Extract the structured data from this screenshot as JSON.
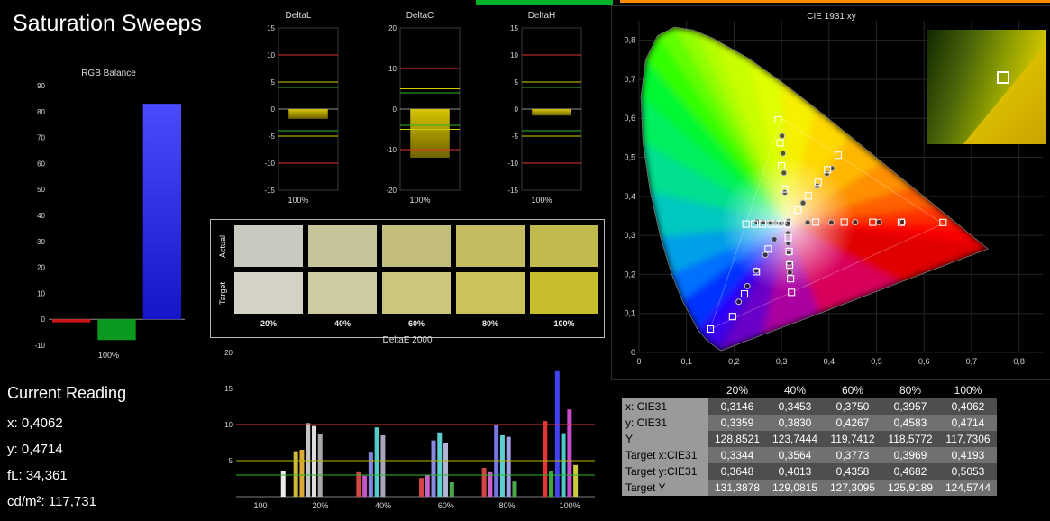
{
  "title": "Saturation Sweeps",
  "current_reading": {
    "heading": "Current Reading",
    "lines": [
      "x: 0,4062",
      "y: 0,4714",
      "fL: 34,361",
      "cd/m²: 117,731"
    ]
  },
  "swatches": {
    "row_labels": [
      "Actual",
      "Target"
    ],
    "col_labels": [
      "20%",
      "40%",
      "60%",
      "80%",
      "100%"
    ],
    "actual": [
      "#cac9c0",
      "#c7c39b",
      "#c4be7e",
      "#c3bc62",
      "#c0b94c"
    ],
    "target": [
      "#d3d2c4",
      "#cfcba0",
      "#ccc67c",
      "#cac25a",
      "#c6bf2b"
    ]
  },
  "table": {
    "headers": [
      "20%",
      "40%",
      "60%",
      "80%",
      "100%"
    ],
    "rows": [
      {
        "label": "x: CIE31",
        "values": [
          "0,3146",
          "0,3453",
          "0,3750",
          "0,3957",
          "0,4062"
        ]
      },
      {
        "label": "y: CIE31",
        "values": [
          "0,3359",
          "0,3830",
          "0,4267",
          "0,4583",
          "0,4714"
        ]
      },
      {
        "label": "Y",
        "values": [
          "128,8521",
          "123,7444",
          "119,7412",
          "118,5772",
          "117,7306"
        ]
      },
      {
        "label": "Target x:CIE31",
        "values": [
          "0,3344",
          "0,3564",
          "0,3773",
          "0,3969",
          "0,4193"
        ]
      },
      {
        "label": "Target y:CIE31",
        "values": [
          "0,3648",
          "0,4013",
          "0,4358",
          "0,4682",
          "0,5053"
        ]
      },
      {
        "label": "Target Y",
        "values": [
          "131,3878",
          "129,0815",
          "127,3095",
          "125,9189",
          "124,5744"
        ]
      }
    ]
  },
  "chart_data": [
    {
      "id": "rgb_balance",
      "type": "bar",
      "title": "RGB Balance",
      "xlabel": "100%",
      "ylim": [
        -10,
        90
      ],
      "yticks": [
        90,
        80,
        70,
        60,
        50,
        40,
        30,
        20,
        10,
        0,
        -10
      ],
      "series": [
        {
          "name": "red",
          "value": -1.2,
          "color": "#cc1414"
        },
        {
          "name": "green",
          "value": -8,
          "color": "#0a9a20"
        },
        {
          "name": "blue",
          "value": 83,
          "color": "#2525e8"
        }
      ]
    },
    {
      "id": "deltaL",
      "type": "delta-bar",
      "title": "DeltaL",
      "xlabel": "100%",
      "ylim": [
        -15,
        15
      ],
      "yticks": [
        15,
        10,
        5,
        0,
        -5,
        -10,
        -15
      ],
      "value": -1.8,
      "ref_lines": [
        {
          "v": 10,
          "color": "#e03434"
        },
        {
          "v": 5,
          "color": "#d0d000"
        },
        {
          "v": 4,
          "color": "#2cb82c"
        },
        {
          "v": -4,
          "color": "#2cb82c"
        },
        {
          "v": -5,
          "color": "#d0d000"
        },
        {
          "v": -10,
          "color": "#e03434"
        }
      ]
    },
    {
      "id": "deltaC",
      "type": "delta-bar",
      "title": "DeltaC",
      "xlabel": "100%",
      "ylim": [
        -20,
        20
      ],
      "yticks": [
        20,
        10,
        0,
        -10,
        -20
      ],
      "value": -12,
      "ref_lines": [
        {
          "v": 10,
          "color": "#e03434"
        },
        {
          "v": 5,
          "color": "#d0d000"
        },
        {
          "v": 4,
          "color": "#2cb82c"
        },
        {
          "v": -4,
          "color": "#2cb82c"
        },
        {
          "v": -5,
          "color": "#d0d000"
        },
        {
          "v": -10,
          "color": "#e03434"
        }
      ]
    },
    {
      "id": "deltaH",
      "type": "delta-bar",
      "title": "DeltaH",
      "xlabel": "100%",
      "ylim": [
        -15,
        15
      ],
      "yticks": [
        15,
        10,
        5,
        0,
        -5,
        -10,
        -15
      ],
      "value": -1.2,
      "ref_lines": [
        {
          "v": 10,
          "color": "#e03434"
        },
        {
          "v": 5,
          "color": "#d0d000"
        },
        {
          "v": 4,
          "color": "#2cb82c"
        },
        {
          "v": -4,
          "color": "#2cb82c"
        },
        {
          "v": -5,
          "color": "#d0d000"
        },
        {
          "v": -10,
          "color": "#e03434"
        }
      ]
    },
    {
      "id": "deltaE2000",
      "type": "history-bar",
      "title": "DeltaE 2000",
      "ylim": [
        0,
        20
      ],
      "yticks": [
        20,
        15,
        10,
        5
      ],
      "xticklabels": [
        "100",
        "20%",
        "40%",
        "60%",
        "80%",
        "100%"
      ],
      "xtickpos": [
        0.068,
        0.235,
        0.41,
        0.585,
        0.755,
        0.93
      ],
      "ref_lines": [
        {
          "v": 10,
          "color": "#e03434"
        },
        {
          "v": 5,
          "color": "#b8b800"
        },
        {
          "v": 3,
          "color": "#2cb82c"
        }
      ],
      "bars": [
        {
          "x": 0.125,
          "h": 3.6,
          "c": "#ececec"
        },
        {
          "x": 0.16,
          "h": 6.3,
          "c": "#cdb93a"
        },
        {
          "x": 0.177,
          "h": 6.5,
          "c": "#d9aa35"
        },
        {
          "x": 0.194,
          "h": 10.2,
          "c": "#c4c4c4"
        },
        {
          "x": 0.211,
          "h": 9.8,
          "c": "#dedede"
        },
        {
          "x": 0.228,
          "h": 8.7,
          "c": "#a9a9a9"
        },
        {
          "x": 0.335,
          "h": 3.4,
          "c": "#d24646"
        },
        {
          "x": 0.352,
          "h": 2.9,
          "c": "#c555c5"
        },
        {
          "x": 0.369,
          "h": 6.1,
          "c": "#8484da"
        },
        {
          "x": 0.386,
          "h": 9.6,
          "c": "#55caca"
        },
        {
          "x": 0.403,
          "h": 8.5,
          "c": "#a6a6bd"
        },
        {
          "x": 0.51,
          "h": 2.6,
          "c": "#d24646"
        },
        {
          "x": 0.527,
          "h": 3.0,
          "c": "#c861c8"
        },
        {
          "x": 0.544,
          "h": 7.8,
          "c": "#8989e2"
        },
        {
          "x": 0.561,
          "h": 8.9,
          "c": "#5cd0d0"
        },
        {
          "x": 0.578,
          "h": 7.5,
          "c": "#b4b4d4"
        },
        {
          "x": 0.595,
          "h": 2.0,
          "c": "#4aa94a"
        },
        {
          "x": 0.685,
          "h": 4.0,
          "c": "#d24646"
        },
        {
          "x": 0.702,
          "h": 3.4,
          "c": "#c861c8"
        },
        {
          "x": 0.719,
          "h": 9.9,
          "c": "#7474e4"
        },
        {
          "x": 0.736,
          "h": 8.5,
          "c": "#5cd0d0"
        },
        {
          "x": 0.753,
          "h": 8.3,
          "c": "#9e9ee6"
        },
        {
          "x": 0.77,
          "h": 2.1,
          "c": "#4aa94a"
        },
        {
          "x": 0.855,
          "h": 10.5,
          "c": "#e23535"
        },
        {
          "x": 0.872,
          "h": 3.6,
          "c": "#3bab3b"
        },
        {
          "x": 0.889,
          "h": 17.4,
          "c": "#4343f2"
        },
        {
          "x": 0.906,
          "h": 8.8,
          "c": "#4ccaca"
        },
        {
          "x": 0.923,
          "h": 12.1,
          "c": "#ca4cca"
        },
        {
          "x": 0.94,
          "h": 4.4,
          "c": "#caca3c"
        }
      ]
    },
    {
      "id": "cie",
      "type": "cie",
      "title": "CIE 1931 xy",
      "xlim": [
        0,
        0.85
      ],
      "ylim": [
        0,
        0.85
      ],
      "ticks": [
        0,
        0.1,
        0.2,
        0.3,
        0.4,
        0.5,
        0.6,
        0.7,
        0.8
      ],
      "tick_labels": [
        "0",
        "0,1",
        "0,2",
        "0,3",
        "0,4",
        "0,5",
        "0,6",
        "0,7",
        "0,8"
      ],
      "targets": [
        [
          0.3127,
          0.329
        ],
        [
          0.372,
          0.334
        ],
        [
          0.432,
          0.3338
        ],
        [
          0.492,
          0.3336
        ],
        [
          0.552,
          0.3334
        ],
        [
          0.64,
          0.333
        ],
        [
          0.306,
          0.419
        ],
        [
          0.3,
          0.478
        ],
        [
          0.297,
          0.537
        ],
        [
          0.293,
          0.596
        ],
        [
          0.272,
          0.265
        ],
        [
          0.247,
          0.207
        ],
        [
          0.222,
          0.15
        ],
        [
          0.197,
          0.092
        ],
        [
          0.15,
          0.06
        ],
        [
          0.3344,
          0.3648
        ],
        [
          0.3564,
          0.4013
        ],
        [
          0.3773,
          0.4358
        ],
        [
          0.3969,
          0.4682
        ],
        [
          0.4193,
          0.5053
        ],
        [
          0.295,
          0.329
        ],
        [
          0.278,
          0.329
        ],
        [
          0.26,
          0.329
        ],
        [
          0.243,
          0.329
        ],
        [
          0.225,
          0.329
        ],
        [
          0.314,
          0.294
        ],
        [
          0.316,
          0.259
        ],
        [
          0.317,
          0.224
        ],
        [
          0.319,
          0.189
        ],
        [
          0.321,
          0.154
        ]
      ],
      "measured": [
        [
          0.3127,
          0.329
        ],
        [
          0.3146,
          0.3359
        ],
        [
          0.3453,
          0.383
        ],
        [
          0.375,
          0.4267
        ],
        [
          0.3957,
          0.4583
        ],
        [
          0.4062,
          0.4714
        ],
        [
          0.355,
          0.333
        ],
        [
          0.405,
          0.333
        ],
        [
          0.455,
          0.3335
        ],
        [
          0.505,
          0.334
        ],
        [
          0.555,
          0.334
        ],
        [
          0.307,
          0.41
        ],
        [
          0.305,
          0.46
        ],
        [
          0.303,
          0.51
        ],
        [
          0.301,
          0.555
        ],
        [
          0.285,
          0.29
        ],
        [
          0.266,
          0.25
        ],
        [
          0.247,
          0.21
        ],
        [
          0.228,
          0.17
        ],
        [
          0.21,
          0.13
        ],
        [
          0.3,
          0.331
        ],
        [
          0.287,
          0.332
        ],
        [
          0.274,
          0.333
        ],
        [
          0.261,
          0.334
        ],
        [
          0.248,
          0.335
        ],
        [
          0.3135,
          0.305
        ],
        [
          0.3145,
          0.28
        ],
        [
          0.3155,
          0.255
        ],
        [
          0.3165,
          0.23
        ],
        [
          0.3175,
          0.205
        ]
      ]
    }
  ]
}
